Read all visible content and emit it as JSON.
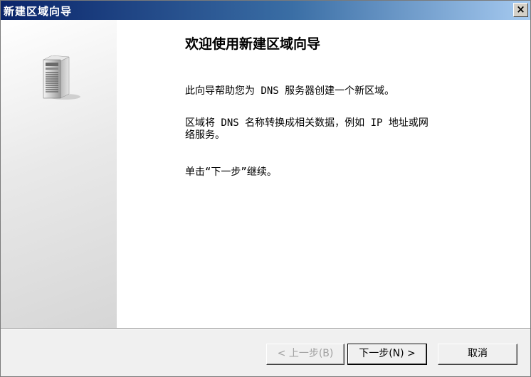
{
  "window": {
    "title": "新建区域向导",
    "close_label": "×"
  },
  "main": {
    "heading": "欢迎使用新建区域向导",
    "para1": "此向导帮助您为 DNS 服务器创建一个新区域。",
    "para2_line1": "区域将 DNS 名称转换成相关数据，例如 IP 地址或网",
    "para2_line2": "络服务。",
    "para3": "单击“下一步”继续。"
  },
  "buttons": {
    "back_label": "< 上一步(B)",
    "next_label": "下一步(N) >",
    "cancel_label": "取消"
  },
  "icons": {
    "server": "server-icon"
  },
  "colors": {
    "titlebar_start": "#0a246a",
    "titlebar_end": "#a6caf0",
    "disabled_text": "#a0a0a0"
  }
}
